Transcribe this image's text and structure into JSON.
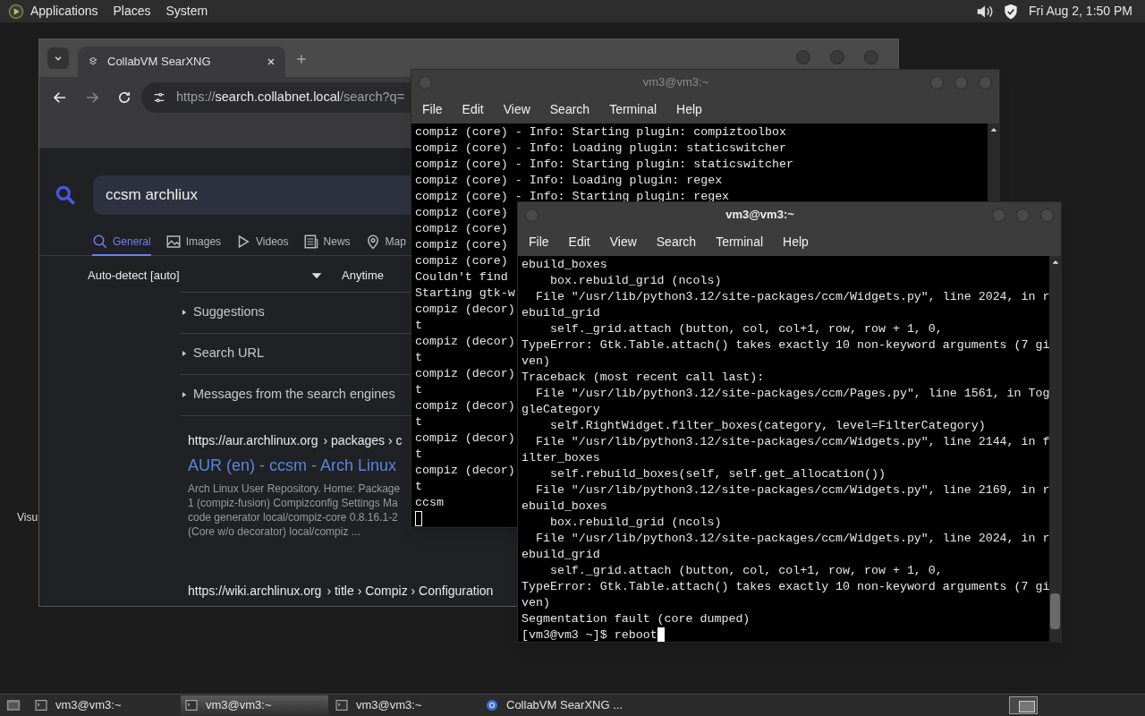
{
  "top_panel": {
    "menus": [
      "Applications",
      "Places",
      "System"
    ],
    "clock": "Fri Aug 2, 1:50 PM"
  },
  "desktop": {
    "icon_label": "Visu"
  },
  "browser": {
    "tabs": [
      {
        "title": "CollabVM SearXNG",
        "selected": true
      }
    ],
    "url": {
      "scheme": "https://",
      "host": "search.collabnet.local",
      "path": "/search?q="
    },
    "query": "ccsm archliux",
    "categories": [
      {
        "label": "General",
        "kind": "search",
        "selected": true
      },
      {
        "label": "Images",
        "kind": "image",
        "selected": false
      },
      {
        "label": "Videos",
        "kind": "video",
        "selected": false
      },
      {
        "label": "News",
        "kind": "news",
        "selected": false
      },
      {
        "label": "Map",
        "kind": "map",
        "selected": false
      }
    ],
    "language": "Auto-detect [auto]",
    "time_range": "Anytime",
    "sections": [
      {
        "label": "Suggestions",
        "expanded": false
      },
      {
        "label": "Search URL",
        "expanded": false
      },
      {
        "label": "Messages from the search engines",
        "expanded": false
      }
    ],
    "results": [
      {
        "url": "https://aur.archlinux.org",
        "breadcrumb": "› packages › c",
        "title": "AUR (en) - ccsm - Arch Linux",
        "snippet_lines": [
          "Arch Linux User Repository. Home: Package",
          "1 (compiz-fusion) Compizconfig Settings Ma",
          "code generator local/compiz-core 0.8.16.1-2",
          "(Core w/o decorator) local/compiz ..."
        ]
      },
      {
        "url": "https://wiki.archlinux.org",
        "breadcrumb": "› title › Compiz › Configuration"
      }
    ]
  },
  "terminals": [
    {
      "title": "vm3@vm3:~",
      "active": false,
      "menus": [
        "File",
        "Edit",
        "View",
        "Search",
        "Terminal",
        "Help"
      ],
      "cursor": true,
      "cursor_on_new_line": true,
      "lines": [
        "compiz (core) - Info: Starting plugin: compiztoolbox",
        "compiz (core) - Info: Loading plugin: staticswitcher",
        "compiz (core) - Info: Starting plugin: staticswitcher",
        "compiz (core) - Info: Loading plugin: regex",
        "compiz (core) - Info: Starting plugin: regex",
        "compiz (core)",
        "compiz (core)",
        "compiz (core)",
        "compiz (core)",
        "Couldn't find",
        "Starting gtk-w",
        "compiz (decor)",
        "t",
        "compiz (decor)",
        "t",
        "compiz (decor)",
        "t",
        "compiz (decor)",
        "t",
        "compiz (decor)",
        "t",
        "compiz (decor)",
        "t",
        "ccsm"
      ]
    },
    {
      "title": "vm3@vm3:~",
      "active": true,
      "menus": [
        "File",
        "Edit",
        "View",
        "Search",
        "Terminal",
        "Help"
      ],
      "cursor": true,
      "lines": [
        "ebuild_boxes",
        "    box.rebuild_grid (ncols)",
        "  File \"/usr/lib/python3.12/site-packages/ccm/Widgets.py\", line 2024, in r",
        "ebuild_grid",
        "    self._grid.attach (button, col, col+1, row, row + 1, 0,",
        "TypeError: Gtk.Table.attach() takes exactly 10 non-keyword arguments (7 gi",
        "ven)",
        "Traceback (most recent call last):",
        "  File \"/usr/lib/python3.12/site-packages/ccm/Pages.py\", line 1561, in Tog",
        "gleCategory",
        "    self.RightWidget.filter_boxes(category, level=FilterCategory)",
        "  File \"/usr/lib/python3.12/site-packages/ccm/Widgets.py\", line 2144, in f",
        "ilter_boxes",
        "    self.rebuild_boxes(self, self.get_allocation())",
        "  File \"/usr/lib/python3.12/site-packages/ccm/Widgets.py\", line 2169, in r",
        "ebuild_boxes",
        "    box.rebuild_grid (ncols)",
        "  File \"/usr/lib/python3.12/site-packages/ccm/Widgets.py\", line 2024, in r",
        "ebuild_grid",
        "    self._grid.attach (button, col, col+1, row, row + 1, 0,",
        "TypeError: Gtk.Table.attach() takes exactly 10 non-keyword arguments (7 gi",
        "ven)",
        "Segmentation fault (core dumped)",
        "[vm3@vm3 ~]$ reboot"
      ]
    }
  ],
  "taskbar": {
    "items": [
      {
        "label": "vm3@vm3:~",
        "kind": "terminal",
        "selected": false
      },
      {
        "label": "vm3@vm3:~",
        "kind": "terminal",
        "selected": true
      },
      {
        "label": "vm3@vm3:~",
        "kind": "terminal",
        "selected": false
      },
      {
        "label": "CollabVM SearXNG ...",
        "kind": "browser",
        "selected": false
      }
    ]
  }
}
